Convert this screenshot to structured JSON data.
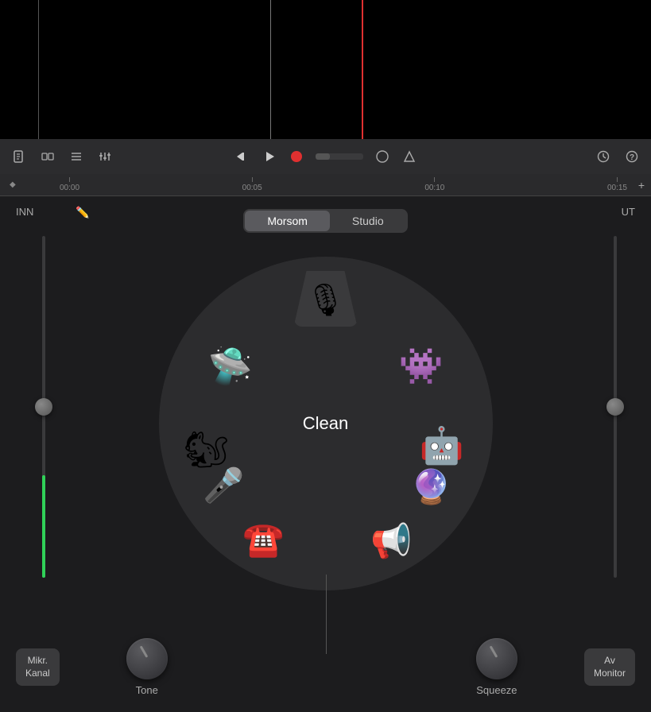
{
  "top": {
    "height": 175
  },
  "toolbar": {
    "icons": [
      "document",
      "thumbnails",
      "list",
      "mixer"
    ],
    "transport": {
      "rewind_label": "⏮",
      "play_label": "▶",
      "record_label": "●"
    },
    "right_icons": [
      "volume",
      "metronome",
      "clock",
      "help"
    ]
  },
  "ruler": {
    "marks": [
      "00:00",
      "00:05",
      "00:10",
      "00:15"
    ],
    "add_label": "+"
  },
  "main": {
    "inn_label": "INN",
    "ut_label": "UT",
    "tabs": [
      {
        "label": "Morsom",
        "active": true
      },
      {
        "label": "Studio",
        "active": false
      }
    ],
    "center_label": "Clean",
    "effects": [
      {
        "name": "microphone",
        "emoji": "🎙️",
        "angle": 0
      },
      {
        "name": "alien",
        "emoji": "🛸",
        "angle": 300
      },
      {
        "name": "monster",
        "emoji": "👾",
        "angle": 60
      },
      {
        "name": "squirrel",
        "emoji": "🐿️",
        "angle": 240
      },
      {
        "name": "robot",
        "emoji": "🤖",
        "angle": 120
      },
      {
        "name": "microphone2",
        "emoji": "🎤",
        "angle": 210
      },
      {
        "name": "orb",
        "emoji": "🔮",
        "angle": 150
      },
      {
        "name": "telephone",
        "emoji": "☎️",
        "angle": 330
      },
      {
        "name": "megaphone",
        "emoji": "📢",
        "angle": 30
      }
    ]
  },
  "bottom": {
    "left_btn": {
      "line1": "Mikr.",
      "line2": "Kanal"
    },
    "tone_knob_label": "Tone",
    "squeeze_knob_label": "Squeeze",
    "right_btn": {
      "line1": "Av",
      "line2": "Monitor"
    }
  },
  "colors": {
    "bg": "#000000",
    "toolbar_bg": "#2c2c2e",
    "main_bg": "#1c1c1e",
    "circle_bg": "#2c2c2e",
    "accent_green": "#30d158",
    "accent_red": "#e03030",
    "text_primary": "#ffffff",
    "text_secondary": "#aaaaaa"
  }
}
